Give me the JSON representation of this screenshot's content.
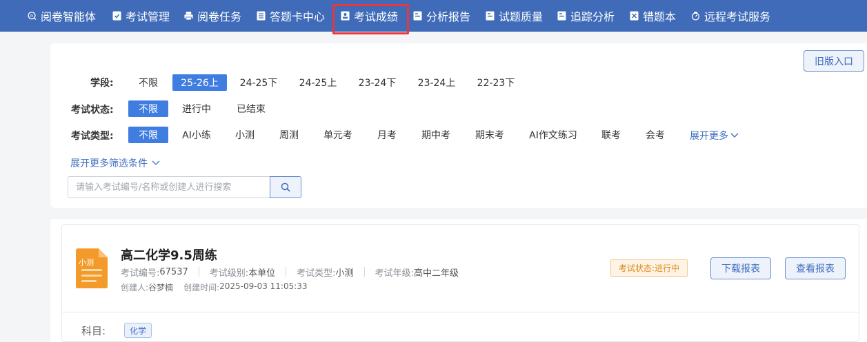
{
  "nav": {
    "items": [
      {
        "label": "阅卷智能体",
        "icon": "ai-brain-icon"
      },
      {
        "label": "考试管理",
        "icon": "clipboard-check-icon"
      },
      {
        "label": "阅卷任务",
        "icon": "printer-icon"
      },
      {
        "label": "答题卡中心",
        "icon": "list-doc-icon"
      },
      {
        "label": "考试成绩",
        "icon": "score-card-icon",
        "active": true
      },
      {
        "label": "分析报告",
        "icon": "report-icon"
      },
      {
        "label": "试题质量",
        "icon": "quality-icon"
      },
      {
        "label": "追踪分析",
        "icon": "tracking-icon"
      },
      {
        "label": "错题本",
        "icon": "wrong-book-icon"
      },
      {
        "label": "远程考试服务",
        "icon": "remote-service-icon"
      }
    ]
  },
  "filters": {
    "old_version_label": "旧版入口",
    "stage": {
      "label": "学段:",
      "options": [
        "不限",
        "25-26上",
        "24-25下",
        "24-25上",
        "23-24下",
        "23-24上",
        "22-23下"
      ],
      "selected": "25-26上"
    },
    "status": {
      "label": "考试状态:",
      "options": [
        "不限",
        "进行中",
        "已结束"
      ],
      "selected": "不限"
    },
    "type": {
      "label": "考试类型:",
      "options": [
        "不限",
        "AI小练",
        "小测",
        "周测",
        "单元考",
        "月考",
        "期中考",
        "期末考",
        "AI作文练习",
        "联考",
        "会考"
      ],
      "selected": "不限",
      "more_label": "展开更多"
    },
    "more_filters_label": "展开更多筛选条件",
    "search_placeholder": "请输入考试编号/名称或创建人进行搜索",
    "search_value": ""
  },
  "exam": {
    "icon_label": "小测",
    "title": "高二化学9.5周练",
    "number_label": "考试编号:",
    "number": "67537",
    "level_label": "考试级别:",
    "level": "本单位",
    "type_label": "考试类型:",
    "type": "小测",
    "grade_label": "考试年级:",
    "grade": "高中二年级",
    "creator_label": "创建人:",
    "creator": "谷梦楠",
    "created_label": "创建时间:",
    "created": "2025-09-03 11:05:33",
    "status_text": "考试状态:进行中",
    "download_label": "下载报表",
    "view_label": "查看报表",
    "subject_label": "科目:",
    "subject": "化学"
  },
  "colors": {
    "nav_bg": "#3f6bb8",
    "accent": "#3f7de0",
    "highlight_border": "#e8383d",
    "status_orange": "#e08717",
    "doc_icon": "#f39a2b"
  }
}
